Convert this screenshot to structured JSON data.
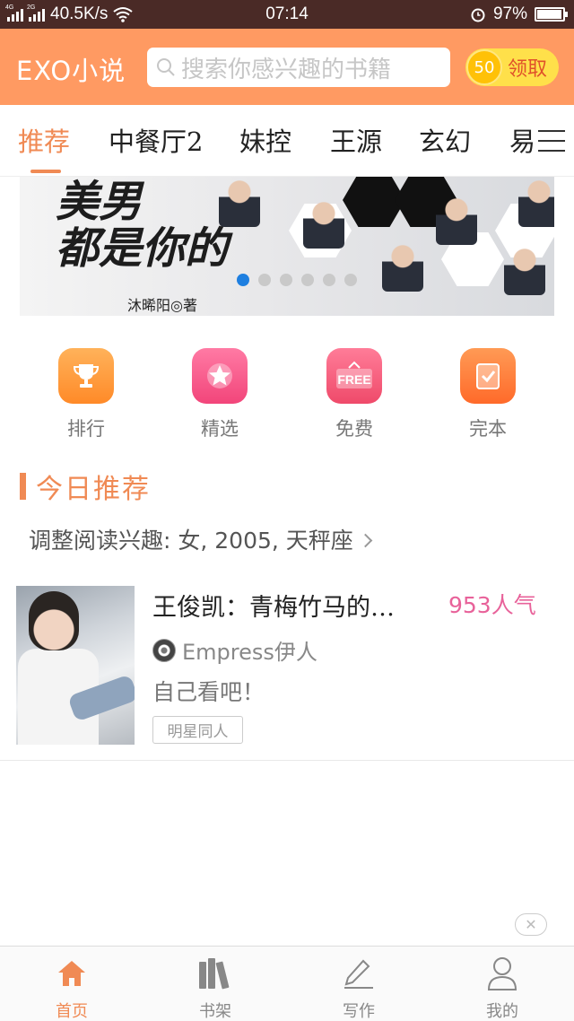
{
  "status_bar": {
    "net_speed": "40.5K/s",
    "time": "07:14",
    "battery": "97%",
    "battery_level": 0.97,
    "sim1_label": "4G",
    "sim2_label": "2G"
  },
  "header": {
    "app_title": "EXO小说",
    "search_placeholder": "搜索你感兴趣的书籍",
    "coin_amount": "50",
    "claim_label": "领取",
    "accent_color": "#ff9a62"
  },
  "tabs": [
    {
      "label": "推荐",
      "active": true
    },
    {
      "label": "中餐厅2",
      "active": false
    },
    {
      "label": "妹控",
      "active": false
    },
    {
      "label": "王源",
      "active": false
    },
    {
      "label": "玄幻",
      "active": false
    },
    {
      "label": "易",
      "active": false
    }
  ],
  "banner": {
    "title_line1": "美男",
    "title_line2": "都是你的",
    "author": "沐晞阳◎著",
    "slide_count": 6,
    "active_slide": 1
  },
  "quick_nav": [
    {
      "label": "排行",
      "icon": "trophy-icon",
      "color": "#ff9a3c"
    },
    {
      "label": "精选",
      "icon": "star-icon",
      "color": "#f7568a"
    },
    {
      "label": "免费",
      "icon": "free-sign-icon",
      "color": "#f25a7a"
    },
    {
      "label": "完本",
      "icon": "checklist-icon",
      "color": "#ff7a3c"
    }
  ],
  "section": {
    "title": "今日推荐",
    "interest_text": "调整阅读兴趣: 女, 2005, 天秤座"
  },
  "book": {
    "title": "王俊凯：青梅竹马的…",
    "popularity": "953人气",
    "author": "Empress伊人",
    "description": "自己看吧！",
    "tag": "明星同人"
  },
  "bottom_nav": [
    {
      "label": "首页",
      "icon": "home-icon",
      "active": true
    },
    {
      "label": "书架",
      "icon": "bookshelf-icon",
      "active": false
    },
    {
      "label": "写作",
      "icon": "pencil-icon",
      "active": false
    },
    {
      "label": "我的",
      "icon": "user-icon",
      "active": false
    }
  ]
}
